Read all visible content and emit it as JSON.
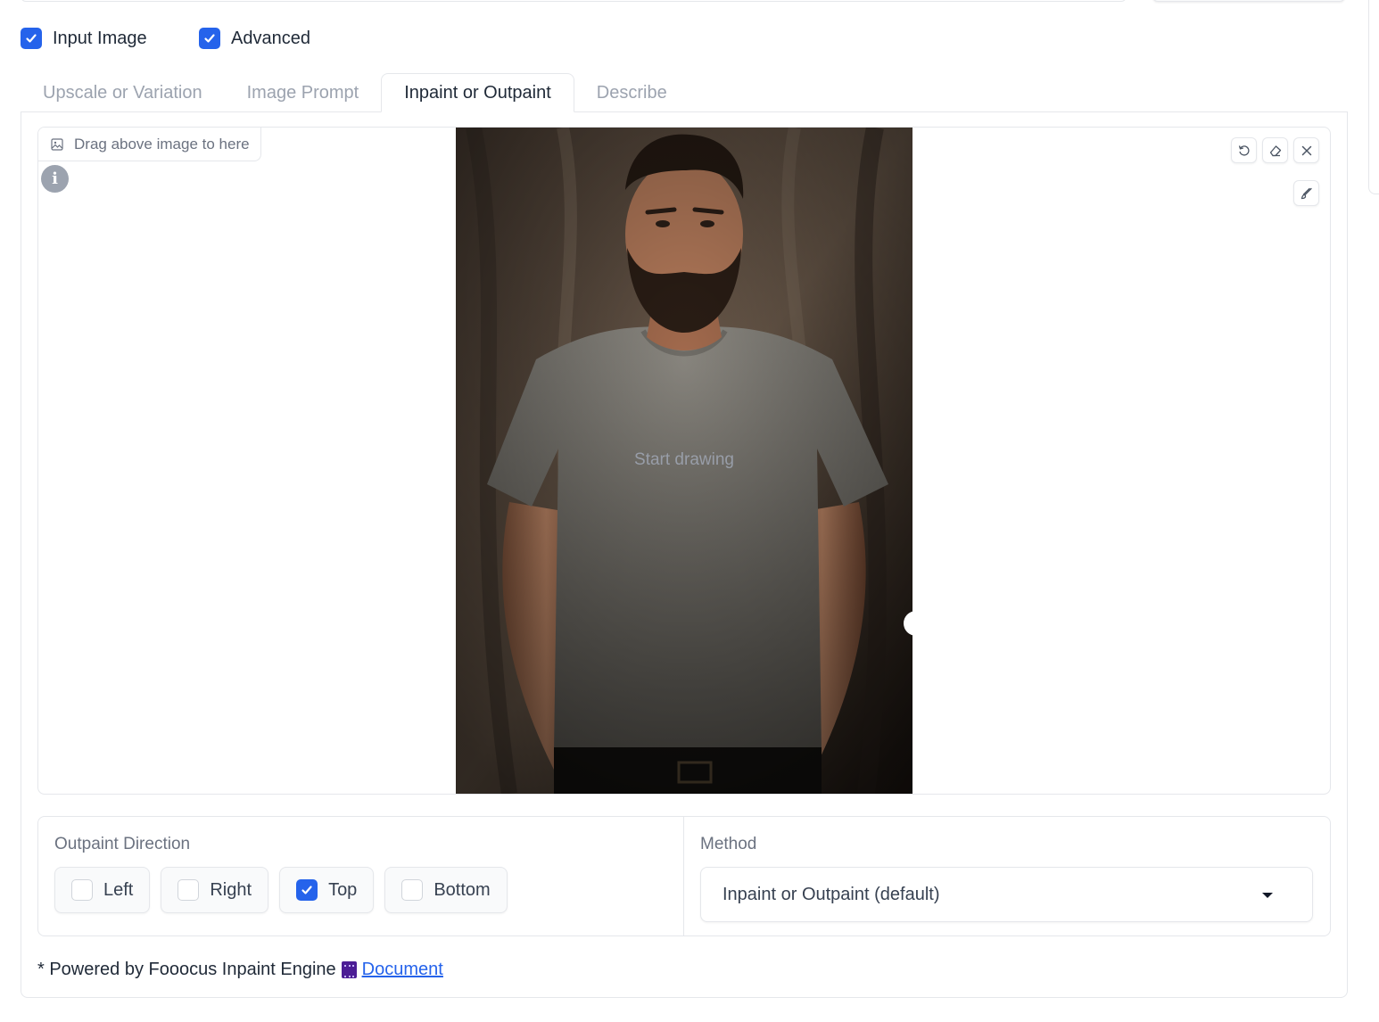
{
  "toggles": [
    {
      "label": "Input Image",
      "checked": true
    },
    {
      "label": "Advanced",
      "checked": true
    }
  ],
  "tabs": [
    {
      "label": "Upscale or Variation",
      "active": false
    },
    {
      "label": "Image Prompt",
      "active": false
    },
    {
      "label": "Inpaint or Outpaint",
      "active": true
    },
    {
      "label": "Describe",
      "active": false
    }
  ],
  "editor": {
    "drag_label": "Drag above image to here",
    "info_icon": "i",
    "overlay_text": "Start drawing",
    "tools": [
      "undo-icon",
      "eraser-icon",
      "close-icon",
      "brush-icon"
    ]
  },
  "outpaint": {
    "title": "Outpaint Direction",
    "directions": [
      {
        "label": "Left",
        "checked": false
      },
      {
        "label": "Right",
        "checked": false
      },
      {
        "label": "Top",
        "checked": true
      },
      {
        "label": "Bottom",
        "checked": false
      }
    ]
  },
  "method": {
    "title": "Method",
    "selected": "Inpaint or Outpaint (default)"
  },
  "footer": {
    "text": "* Powered by Fooocus Inpaint Engine",
    "link_label": "Document"
  },
  "colors": {
    "accent": "#2563eb",
    "border": "#e5e7eb",
    "muted_text": "#6b7280"
  }
}
